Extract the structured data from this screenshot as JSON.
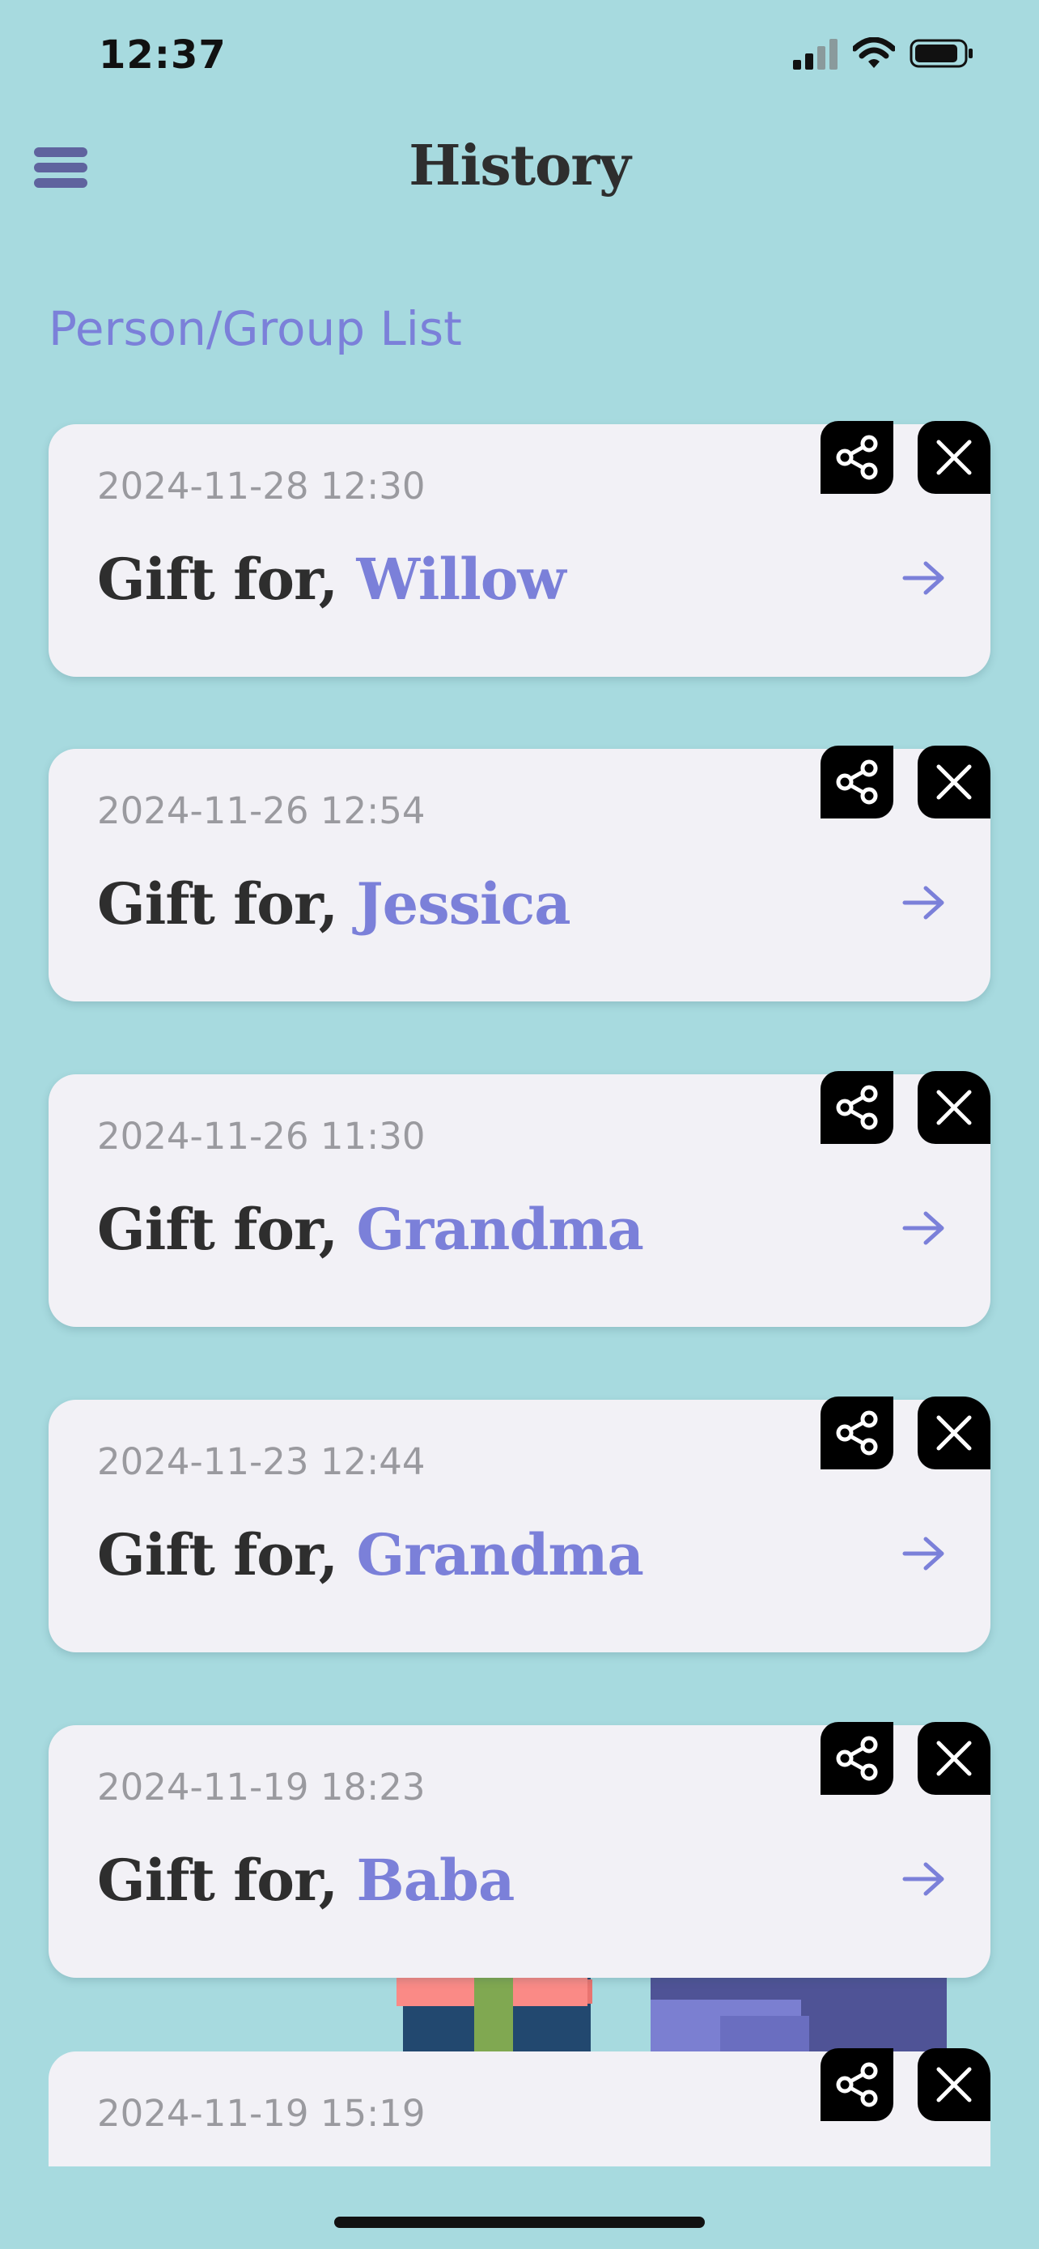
{
  "status_bar": {
    "time": "12:37"
  },
  "header": {
    "title": "History",
    "menu_icon": "hamburger-menu-icon"
  },
  "section": {
    "link_label": "Person/Group List"
  },
  "colors": {
    "background": "#a7dadf",
    "accent": "#7b80d9",
    "card": "#f2f1f6",
    "title_text": "#2e2e2e",
    "date_text": "#9a9a9f",
    "action_button": "#000000"
  },
  "history": [
    {
      "date": "2024-11-28 12:30",
      "prefix": "Gift for, ",
      "recipient": "Willow"
    },
    {
      "date": "2024-11-26 12:54",
      "prefix": "Gift for, ",
      "recipient": "Jessica"
    },
    {
      "date": "2024-11-26 11:30",
      "prefix": "Gift for, ",
      "recipient": "Grandma"
    },
    {
      "date": "2024-11-23 12:44",
      "prefix": "Gift for, ",
      "recipient": "Grandma"
    },
    {
      "date": "2024-11-19 18:23",
      "prefix": "Gift for, ",
      "recipient": "Baba"
    },
    {
      "date": "2024-11-19 15:19"
    }
  ],
  "icons": {
    "share": "share-icon",
    "close": "close-icon",
    "arrow": "arrow-right-icon"
  }
}
